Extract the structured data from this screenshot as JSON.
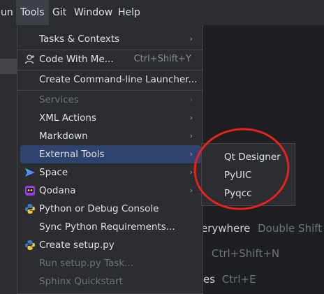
{
  "menubar": {
    "items": [
      {
        "label": "un"
      },
      {
        "label": "Tools"
      },
      {
        "label": "Git"
      },
      {
        "label": "Window"
      },
      {
        "label": "Help"
      }
    ]
  },
  "tools_menu": {
    "items": [
      {
        "label": "Tasks & Contexts"
      },
      {
        "label": "Code With Me...",
        "shortcut": "Ctrl+Shift+Y"
      },
      {
        "label": "Create Command-line Launcher..."
      },
      {
        "label": "Services"
      },
      {
        "label": "XML Actions"
      },
      {
        "label": "Markdown"
      },
      {
        "label": "External Tools"
      },
      {
        "label": "Space"
      },
      {
        "label": "Qodana"
      },
      {
        "label": "Python or Debug Console"
      },
      {
        "label": "Sync Python Requirements..."
      },
      {
        "label": "Create setup.py"
      },
      {
        "label": "Run setup.py Task..."
      },
      {
        "label": "Sphinx Quickstart"
      }
    ],
    "submenu_arrow": "›"
  },
  "external_tools_submenu": {
    "items": [
      {
        "label": "Qt Designer"
      },
      {
        "label": "PyUIC"
      },
      {
        "label": "Pyqcc"
      }
    ]
  },
  "editor_hints": {
    "search_everywhere": {
      "action": "erywhere",
      "shortcut": "Double Shift"
    },
    "go_to_file": {
      "shortcut": "Ctrl+Shift+N"
    },
    "recent_files": {
      "action": "es",
      "shortcut": "Ctrl+E"
    }
  },
  "colors": {
    "annotation_circle": "#e8231d",
    "highlight": "#2e436e"
  },
  "icons": {
    "code_with_me": "user-add-icon",
    "space": "space-logo-icon",
    "qodana": "qodana-logo-icon",
    "python_console": "python-icon",
    "create_setup": "python-icon"
  }
}
